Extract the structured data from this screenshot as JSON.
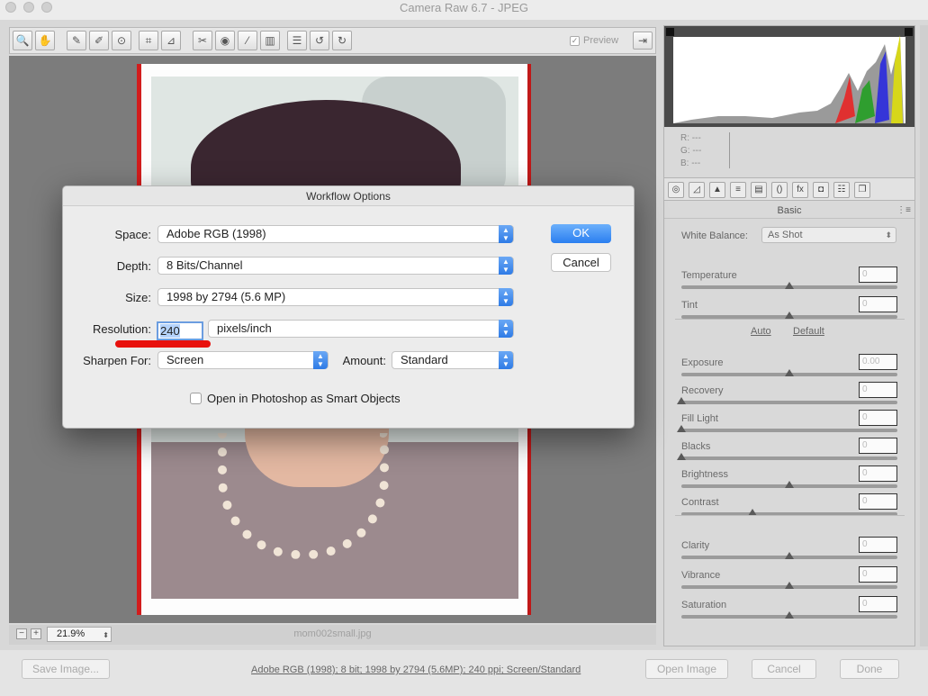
{
  "window": {
    "title": "Camera Raw 6.7  -  JPEG"
  },
  "toolbar": {
    "tools": [
      {
        "icon": "zoom-icon",
        "glyph": "🔍"
      },
      {
        "icon": "hand-icon",
        "glyph": "✋"
      },
      {
        "icon": "white-balance-icon",
        "glyph": "✎"
      },
      {
        "icon": "color-sampler-icon",
        "glyph": "✐"
      },
      {
        "icon": "targeted-adjustment-icon",
        "glyph": "⊙"
      },
      {
        "icon": "crop-icon",
        "glyph": "⌗"
      },
      {
        "icon": "straighten-icon",
        "glyph": "⊿"
      },
      {
        "icon": "spot-removal-icon",
        "glyph": "✂"
      },
      {
        "icon": "red-eye-icon",
        "glyph": "◉"
      },
      {
        "icon": "adjustment-brush-icon",
        "glyph": "⁄"
      },
      {
        "icon": "graduated-filter-icon",
        "glyph": "▥"
      },
      {
        "icon": "preferences-icon",
        "glyph": "☰"
      },
      {
        "icon": "rotate-left-icon",
        "glyph": "↺"
      },
      {
        "icon": "rotate-right-icon",
        "glyph": "↻"
      }
    ],
    "preview_label": "Preview",
    "preview_checked": "✓"
  },
  "preview": {
    "zoom": "21.9%",
    "filename": "mom002small.jpg"
  },
  "right_panel": {
    "readout": {
      "r": "R:  ---",
      "g": "G:  ---",
      "b": "B:  ---"
    },
    "heading": "Basic",
    "white_balance_label": "White Balance:",
    "white_balance_value": "As Shot",
    "auto_label": "Auto",
    "default_label": "Default",
    "sliders": [
      {
        "label": "Temperature",
        "value": "0",
        "level": 0.5
      },
      {
        "label": "Tint",
        "value": "0",
        "level": 0.5
      },
      {
        "label": "Exposure",
        "value": "0.00",
        "level": 0.5
      },
      {
        "label": "Recovery",
        "value": "0",
        "level": 0.0
      },
      {
        "label": "Fill Light",
        "value": "0",
        "level": 0.0
      },
      {
        "label": "Blacks",
        "value": "0",
        "level": 0.0
      },
      {
        "label": "Brightness",
        "value": "0",
        "level": 0.5
      },
      {
        "label": "Contrast",
        "value": "0",
        "level": 0.33
      },
      {
        "label": "Clarity",
        "value": "0",
        "level": 0.5
      },
      {
        "label": "Vibrance",
        "value": "0",
        "level": 0.5
      },
      {
        "label": "Saturation",
        "value": "0",
        "level": 0.5
      }
    ]
  },
  "bottom": {
    "save_image": "Save Image...",
    "workflow_link": "Adobe RGB (1998); 8 bit; 1998 by 2794 (5.6MP); 240 ppi; Screen/Standard",
    "open_image": "Open Image",
    "cancel": "Cancel",
    "done": "Done"
  },
  "dialog": {
    "title": "Workflow Options",
    "space_label": "Space:",
    "space_value": "Adobe RGB (1998)",
    "depth_label": "Depth:",
    "depth_value": "8 Bits/Channel",
    "size_label": "Size:",
    "size_value": "1998 by 2794  (5.6 MP)",
    "resolution_label": "Resolution:",
    "resolution_value": "240",
    "resolution_unit": "pixels/inch",
    "sharpen_label": "Sharpen For:",
    "sharpen_value": "Screen",
    "amount_label": "Amount:",
    "amount_value": "Standard",
    "smart_objects_label": "Open in Photoshop as Smart Objects",
    "ok": "OK",
    "cancel": "Cancel"
  }
}
